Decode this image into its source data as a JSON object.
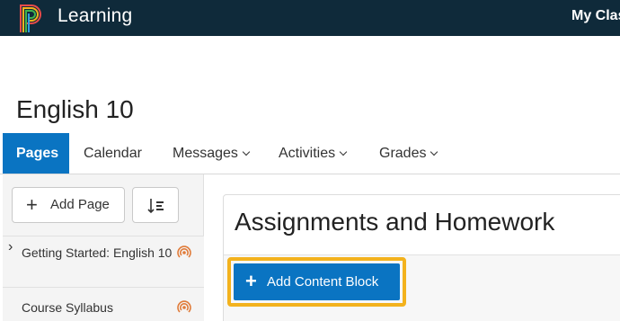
{
  "header": {
    "brand": "Learning",
    "my_classes_label": "My Clas"
  },
  "course": {
    "title": "English 10"
  },
  "nav": {
    "tabs": [
      {
        "label": "Pages",
        "active": true,
        "has_menu": false
      },
      {
        "label": "Calendar",
        "active": false,
        "has_menu": false
      },
      {
        "label": "Messages",
        "active": false,
        "has_menu": true
      },
      {
        "label": "Activities",
        "active": false,
        "has_menu": true
      },
      {
        "label": "Grades",
        "active": false,
        "has_menu": true
      }
    ]
  },
  "sidebar": {
    "add_page_label": "Add Page",
    "sort_icon": "sort-order-icon",
    "pages": [
      {
        "label": "Getting Started: English 10",
        "expandable": true,
        "icon": "broadcast-icon"
      },
      {
        "label": "Course Syllabus",
        "expandable": false,
        "icon": "broadcast-icon"
      }
    ]
  },
  "main": {
    "section_title": "Assignments and Homework",
    "add_content_block_label": "Add Content Block"
  },
  "colors": {
    "topbar": "#0f2a3a",
    "accent": "#0a74c2",
    "highlight": "#f3b21d",
    "broadcast_icon": "#e07b39"
  }
}
